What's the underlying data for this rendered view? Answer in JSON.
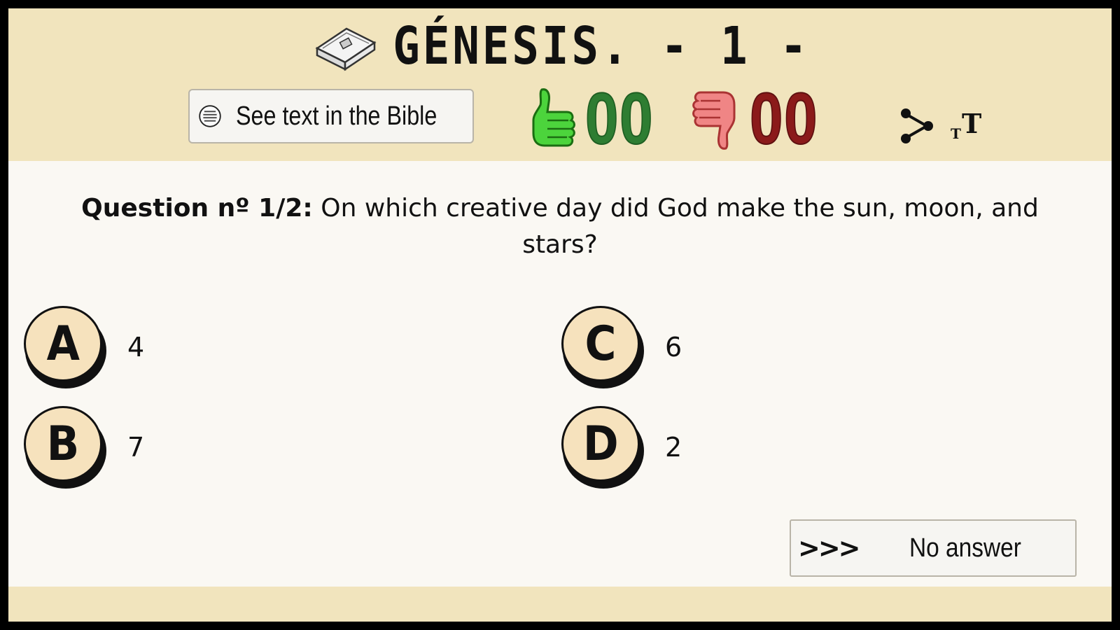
{
  "header": {
    "title": "GÉNESIS. - 1 -",
    "bible_button_label": "See text in the Bible",
    "correct_count": "00",
    "wrong_count": "00"
  },
  "question": {
    "label": "Question nº 1/2:",
    "text": " On which creative day did God make the sun, moon, and stars?"
  },
  "options": [
    {
      "letter": "A",
      "value": "4"
    },
    {
      "letter": "B",
      "value": "7"
    },
    {
      "letter": "C",
      "value": "6"
    },
    {
      "letter": "D",
      "value": "2"
    }
  ],
  "no_answer": {
    "arrows": ">>>",
    "label": "No answer"
  },
  "colors": {
    "header_bg": "#f1e4bd",
    "correct": "#2e7d32",
    "wrong": "#8b1a1a",
    "badge": "#f6e2bd"
  },
  "icons": [
    "book-icon",
    "list-icon",
    "thumbs-up-icon",
    "thumbs-down-icon",
    "share-icon",
    "font-size-icon"
  ]
}
